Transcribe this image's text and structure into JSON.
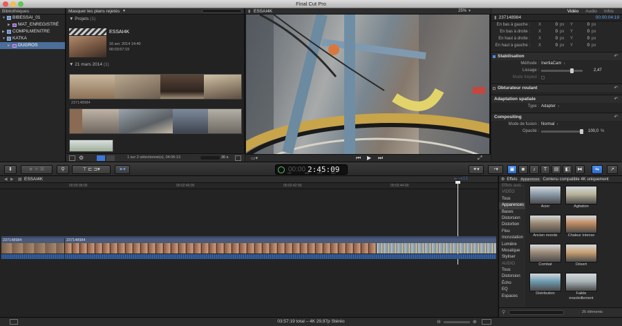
{
  "app": {
    "title": "Final Cut Pro"
  },
  "libraries": {
    "header": "Bibliothèques",
    "items": [
      {
        "label": "BIBESSAI_01",
        "type": "lib",
        "indent": 0,
        "open": true,
        "selected": false
      },
      {
        "label": "MAT_ENREGISTRÉ",
        "type": "event",
        "indent": 1,
        "open": false,
        "selected": false
      },
      {
        "label": "COMPILMENITRE",
        "type": "lib",
        "indent": 0,
        "open": false,
        "selected": false
      },
      {
        "label": "KATKA",
        "type": "lib",
        "indent": 0,
        "open": true,
        "selected": false
      },
      {
        "label": "DUGROS",
        "type": "event",
        "indent": 1,
        "open": false,
        "selected": true
      }
    ]
  },
  "browser": {
    "filter": "Masquer les plans rejetés",
    "projects_label": "Projets",
    "projects_count": "(1)",
    "project": {
      "name": "ESSAI4K",
      "date": "16 avr. 2014 14:40",
      "duration": "00:03:57:19"
    },
    "date_group": "21 mars 2014",
    "date_group_count": "(1)",
    "clip_name": "237148984",
    "selection_info": "1 sur 2 sélectionné(s), 04:06:13",
    "zoom_value": "30 s"
  },
  "viewer": {
    "title": "ESSAI4K",
    "zoom": "25%",
    "view_label": "Présentation"
  },
  "inspector": {
    "clip": "237148984",
    "timecode": "00:00:04:19",
    "tabs": [
      "Vidéo",
      "Audio",
      "Infos"
    ],
    "active_tab": "Vidéo",
    "crop_rows": [
      {
        "label": "En bas à gauche :",
        "x": "0",
        "y": "0",
        "unit": "px"
      },
      {
        "label": "En bas à droite :",
        "x": "0",
        "y": "0",
        "unit": "px"
      },
      {
        "label": "En haut à droite :",
        "x": "0",
        "y": "0",
        "unit": "px"
      },
      {
        "label": "En haut à gauche :",
        "x": "0",
        "y": "0",
        "unit": "px"
      }
    ],
    "x_label": "X",
    "y_label": "Y",
    "stabilisation": {
      "title": "Stabilisation",
      "method_label": "Méthode :",
      "method_value": "InertiaCam",
      "smoothing_label": "Lissage :",
      "smoothing_value": "2,47",
      "tripod_label": "Mode trépied :"
    },
    "rolling_shutter": {
      "title": "Obturateur roulant"
    },
    "spatial": {
      "title": "Adaptation spatiale",
      "type_label": "Type :",
      "type_value": "Adapter"
    },
    "compositing": {
      "title": "Compositing",
      "blend_label": "Mode de fusion :",
      "blend_value": "Normal",
      "opacity_label": "Opacité :",
      "opacity_value": "100,0",
      "opacity_unit": "%"
    }
  },
  "toolbar": {
    "timecode": "2:45:09",
    "tc_prefix": "00:00",
    "tc_hr": "HR",
    "tc_min": "MIN",
    "tc_sec": "SEC",
    "tc_fr": "IMG"
  },
  "timeline": {
    "project": "ESSAI4K",
    "ruler": [
      "00:00:38:00",
      "00:02:40:00",
      "00:02:42:00",
      "00:02:44:00"
    ],
    "clips": [
      "237148984",
      "237148984"
    ]
  },
  "effects": {
    "title": "Effets",
    "badge": "Apparences",
    "header_info": "Contenu compatible 4K uniquement",
    "categories": [
      {
        "label": "Effets aud...",
        "kind": "hdr"
      },
      {
        "label": "VIDÉO",
        "kind": "hdr"
      },
      {
        "label": "Tous",
        "kind": ""
      },
      {
        "label": "Apparences",
        "kind": "sel"
      },
      {
        "label": "Bases",
        "kind": ""
      },
      {
        "label": "Distorsion",
        "kind": ""
      },
      {
        "label": "Distortion",
        "kind": ""
      },
      {
        "label": "Flou",
        "kind": ""
      },
      {
        "label": "Incrustation",
        "kind": ""
      },
      {
        "label": "Lumière",
        "kind": ""
      },
      {
        "label": "Mosaïque",
        "kind": ""
      },
      {
        "label": "Styliser",
        "kind": ""
      },
      {
        "label": "AUDIO",
        "kind": "hdr"
      },
      {
        "label": "Tous",
        "kind": ""
      },
      {
        "label": "Distorsion",
        "kind": ""
      },
      {
        "label": "Écho",
        "kind": ""
      },
      {
        "label": "EQ",
        "kind": ""
      },
      {
        "label": "Espaces",
        "kind": ""
      }
    ],
    "items": [
      {
        "label": "Acier",
        "color": "#8a9aa8"
      },
      {
        "label": "Agitation",
        "color": "#b8b29a"
      },
      {
        "label": "Ancien monde",
        "color": "#9a8870"
      },
      {
        "label": "Chaleur intense",
        "color": "#c08a60"
      },
      {
        "label": "Combat",
        "color": "#9c8a78"
      },
      {
        "label": "Désert",
        "color": "#c9a173"
      },
      {
        "label": "Distribution",
        "color": "#6e9cb0"
      },
      {
        "label": "Faible ensoleillement",
        "color": "#a9b4b8"
      }
    ],
    "count": "26 éléments"
  },
  "status": {
    "text": "03:57:19 total – 4K 29,97p Stéréo"
  }
}
